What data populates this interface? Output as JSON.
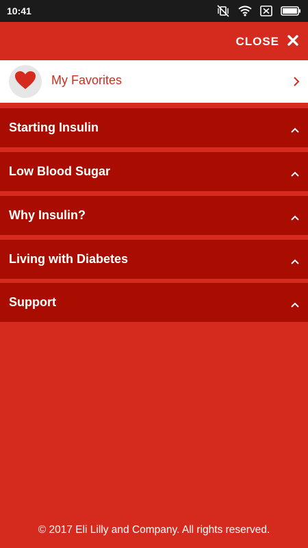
{
  "status_bar": {
    "time": "10:41",
    "icons": [
      "vibrate-off-icon",
      "wifi-icon",
      "sim-icon",
      "battery-icon"
    ]
  },
  "header": {
    "close_label": "CLOSE",
    "close_icon": "close-icon"
  },
  "favorites": {
    "label": "My Favorites",
    "icon": "heart-icon",
    "accent": "#d52b1e"
  },
  "menu": {
    "items": [
      {
        "label": "Starting Insulin"
      },
      {
        "label": "Low Blood Sugar"
      },
      {
        "label": "Why Insulin?"
      },
      {
        "label": "Living with Diabetes"
      },
      {
        "label": "Support"
      }
    ]
  },
  "footer": {
    "copyright": "© 2017 Eli Lilly and Company. All rights reserved."
  },
  "colors": {
    "background": "#d52b1e",
    "menu_item": "#a90c00",
    "status_bar": "#1b1b1b",
    "favorites_bg": "#ffffff"
  }
}
